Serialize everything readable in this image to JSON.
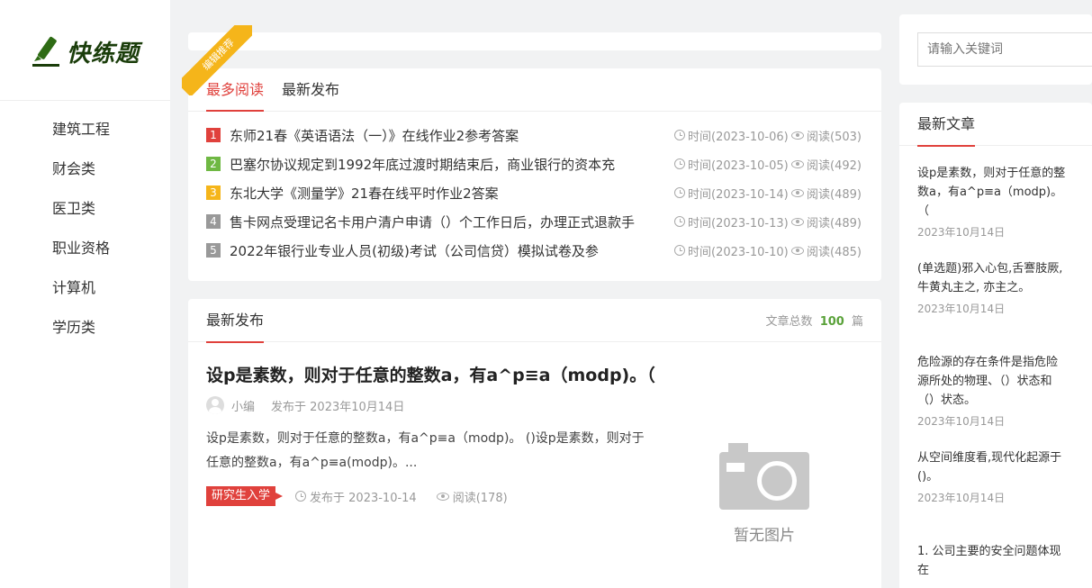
{
  "brand": {
    "name": "快练题"
  },
  "nav": [
    "建筑工程",
    "财会类",
    "医卫类",
    "职业资格",
    "计算机",
    "学历类"
  ],
  "ribbon": "编辑推荐",
  "tabs": [
    {
      "label": "最多阅读",
      "active": true
    },
    {
      "label": "最新发布",
      "active": false
    }
  ],
  "ranking": [
    {
      "num": "1",
      "color": "#e0413c",
      "title": "东师21春《英语语法（一）》在线作业2参考答案",
      "time": "时间(2023-10-06)",
      "views": "阅读(503)"
    },
    {
      "num": "2",
      "color": "#6fb843",
      "title": "巴塞尔协议规定到1992年底过渡时期结束后，商业银行的资本充",
      "time": "时间(2023-10-05)",
      "views": "阅读(492)"
    },
    {
      "num": "3",
      "color": "#f5b51a",
      "title": "东北大学《测量学》21春在线平时作业2答案",
      "time": "时间(2023-10-14)",
      "views": "阅读(489)"
    },
    {
      "num": "4",
      "color": "#999999",
      "title": "售卡网点受理记名卡用户清户申请（）个工作日后，办理正式退款手",
      "time": "时间(2023-10-13)",
      "views": "阅读(489)"
    },
    {
      "num": "5",
      "color": "#999999",
      "title": "2022年银行业专业人员(初级)考试（公司信贷）模拟试卷及参",
      "time": "时间(2023-10-10)",
      "views": "阅读(485)"
    }
  ],
  "latest": {
    "heading": "最新发布",
    "total_prefix": "文章总数",
    "total_num": "100",
    "total_suffix": "篇",
    "post": {
      "title": "设p是素数，则对于任意的整数a，有a^p≡a（modp)。（",
      "author": "小编",
      "published": "发布于 2023年10月14日",
      "excerpt": "设p是素数，则对于任意的整数a，有a^p≡a（modp)。 ()设p是素数，则对于任意的整数a，有a^p≡a(modp)。...",
      "tag": "研究生入学",
      "foot_date": "发布于 2023-10-14",
      "foot_views": "阅读(178)",
      "no_image": "暂无图片"
    }
  },
  "search": {
    "placeholder": "请输入关键词"
  },
  "news": {
    "heading": "最新文章",
    "items": [
      {
        "text": "设p是素数，则对于任意的整数a，有a^p≡a（modp)。（",
        "date": "2023年10月14日"
      },
      {
        "text": "(单选题)邪入心包,舌謇肢厥,牛黄丸主之, 亦主之。",
        "date": "2023年10月14日"
      },
      {
        "text": "危险源的存在条件是指危险源所处的物理、（）状态和（）状态。",
        "date": "2023年10月14日"
      },
      {
        "text": "从空间维度看,现代化起源于()。",
        "date": "2023年10月14日"
      },
      {
        "text": "1. 公司主要的安全问题体现在",
        "date": ""
      }
    ]
  }
}
